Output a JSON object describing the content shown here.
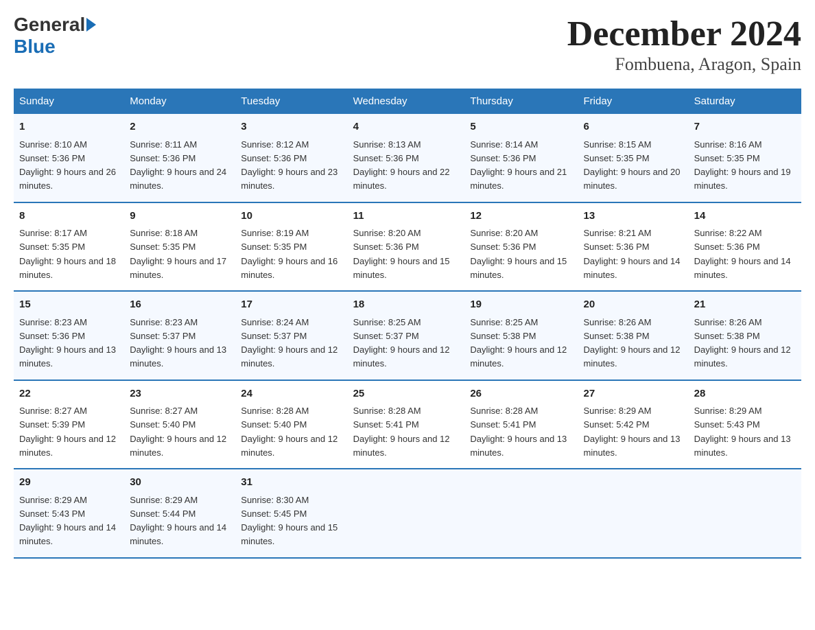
{
  "logo": {
    "general": "General",
    "blue": "Blue"
  },
  "title": "December 2024",
  "subtitle": "Fombuena, Aragon, Spain",
  "headers": [
    "Sunday",
    "Monday",
    "Tuesday",
    "Wednesday",
    "Thursday",
    "Friday",
    "Saturday"
  ],
  "weeks": [
    [
      {
        "day": "1",
        "sunrise": "8:10 AM",
        "sunset": "5:36 PM",
        "daylight": "9 hours and 26 minutes."
      },
      {
        "day": "2",
        "sunrise": "8:11 AM",
        "sunset": "5:36 PM",
        "daylight": "9 hours and 24 minutes."
      },
      {
        "day": "3",
        "sunrise": "8:12 AM",
        "sunset": "5:36 PM",
        "daylight": "9 hours and 23 minutes."
      },
      {
        "day": "4",
        "sunrise": "8:13 AM",
        "sunset": "5:36 PM",
        "daylight": "9 hours and 22 minutes."
      },
      {
        "day": "5",
        "sunrise": "8:14 AM",
        "sunset": "5:36 PM",
        "daylight": "9 hours and 21 minutes."
      },
      {
        "day": "6",
        "sunrise": "8:15 AM",
        "sunset": "5:35 PM",
        "daylight": "9 hours and 20 minutes."
      },
      {
        "day": "7",
        "sunrise": "8:16 AM",
        "sunset": "5:35 PM",
        "daylight": "9 hours and 19 minutes."
      }
    ],
    [
      {
        "day": "8",
        "sunrise": "8:17 AM",
        "sunset": "5:35 PM",
        "daylight": "9 hours and 18 minutes."
      },
      {
        "day": "9",
        "sunrise": "8:18 AM",
        "sunset": "5:35 PM",
        "daylight": "9 hours and 17 minutes."
      },
      {
        "day": "10",
        "sunrise": "8:19 AM",
        "sunset": "5:35 PM",
        "daylight": "9 hours and 16 minutes."
      },
      {
        "day": "11",
        "sunrise": "8:20 AM",
        "sunset": "5:36 PM",
        "daylight": "9 hours and 15 minutes."
      },
      {
        "day": "12",
        "sunrise": "8:20 AM",
        "sunset": "5:36 PM",
        "daylight": "9 hours and 15 minutes."
      },
      {
        "day": "13",
        "sunrise": "8:21 AM",
        "sunset": "5:36 PM",
        "daylight": "9 hours and 14 minutes."
      },
      {
        "day": "14",
        "sunrise": "8:22 AM",
        "sunset": "5:36 PM",
        "daylight": "9 hours and 14 minutes."
      }
    ],
    [
      {
        "day": "15",
        "sunrise": "8:23 AM",
        "sunset": "5:36 PM",
        "daylight": "9 hours and 13 minutes."
      },
      {
        "day": "16",
        "sunrise": "8:23 AM",
        "sunset": "5:37 PM",
        "daylight": "9 hours and 13 minutes."
      },
      {
        "day": "17",
        "sunrise": "8:24 AM",
        "sunset": "5:37 PM",
        "daylight": "9 hours and 12 minutes."
      },
      {
        "day": "18",
        "sunrise": "8:25 AM",
        "sunset": "5:37 PM",
        "daylight": "9 hours and 12 minutes."
      },
      {
        "day": "19",
        "sunrise": "8:25 AM",
        "sunset": "5:38 PM",
        "daylight": "9 hours and 12 minutes."
      },
      {
        "day": "20",
        "sunrise": "8:26 AM",
        "sunset": "5:38 PM",
        "daylight": "9 hours and 12 minutes."
      },
      {
        "day": "21",
        "sunrise": "8:26 AM",
        "sunset": "5:38 PM",
        "daylight": "9 hours and 12 minutes."
      }
    ],
    [
      {
        "day": "22",
        "sunrise": "8:27 AM",
        "sunset": "5:39 PM",
        "daylight": "9 hours and 12 minutes."
      },
      {
        "day": "23",
        "sunrise": "8:27 AM",
        "sunset": "5:40 PM",
        "daylight": "9 hours and 12 minutes."
      },
      {
        "day": "24",
        "sunrise": "8:28 AM",
        "sunset": "5:40 PM",
        "daylight": "9 hours and 12 minutes."
      },
      {
        "day": "25",
        "sunrise": "8:28 AM",
        "sunset": "5:41 PM",
        "daylight": "9 hours and 12 minutes."
      },
      {
        "day": "26",
        "sunrise": "8:28 AM",
        "sunset": "5:41 PM",
        "daylight": "9 hours and 13 minutes."
      },
      {
        "day": "27",
        "sunrise": "8:29 AM",
        "sunset": "5:42 PM",
        "daylight": "9 hours and 13 minutes."
      },
      {
        "day": "28",
        "sunrise": "8:29 AM",
        "sunset": "5:43 PM",
        "daylight": "9 hours and 13 minutes."
      }
    ],
    [
      {
        "day": "29",
        "sunrise": "8:29 AM",
        "sunset": "5:43 PM",
        "daylight": "9 hours and 14 minutes."
      },
      {
        "day": "30",
        "sunrise": "8:29 AM",
        "sunset": "5:44 PM",
        "daylight": "9 hours and 14 minutes."
      },
      {
        "day": "31",
        "sunrise": "8:30 AM",
        "sunset": "5:45 PM",
        "daylight": "9 hours and 15 minutes."
      },
      null,
      null,
      null,
      null
    ]
  ]
}
